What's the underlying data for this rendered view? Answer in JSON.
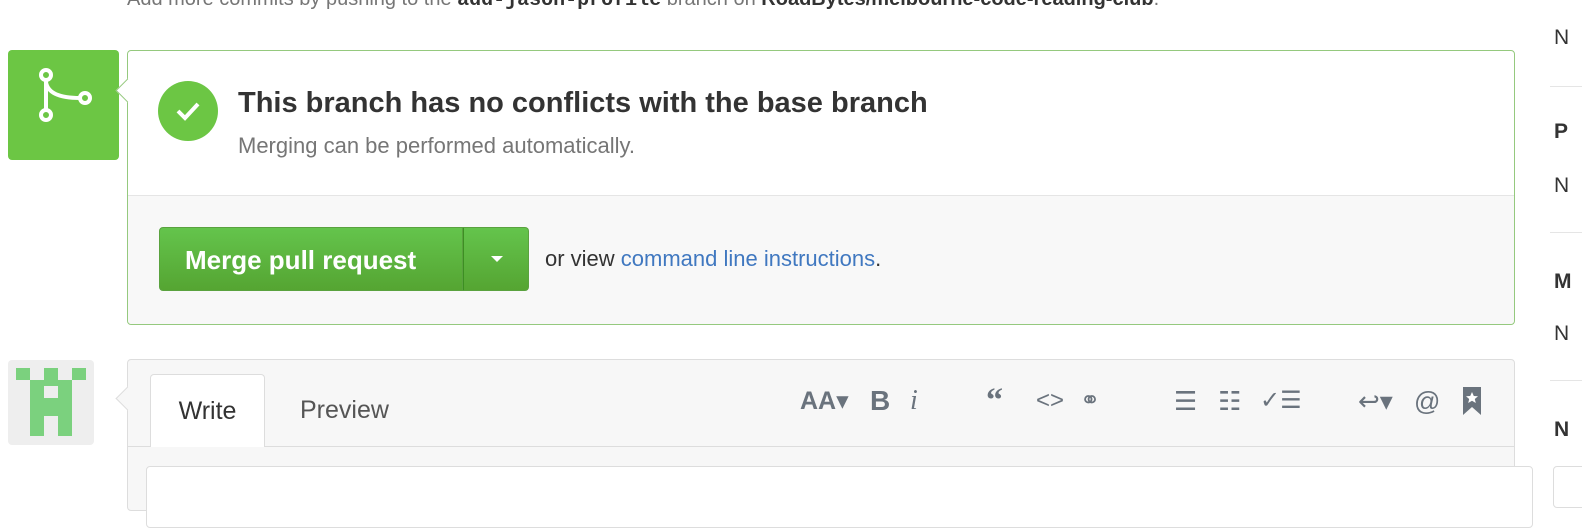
{
  "top_note": {
    "prefix": "Add more commits by pushing to the ",
    "branch": "add-jason-profile",
    "middle": " branch on ",
    "repo": "RoadBytes/melbourne-code-reading-club",
    "suffix": "."
  },
  "merge_status": {
    "title": "This branch has no conflicts with the base branch",
    "subtitle": "Merging can be performed automatically."
  },
  "merge_actions": {
    "merge_button_label": "Merge pull request",
    "or_view_text": "or view ",
    "command_line_link": "command line instructions",
    "period": "."
  },
  "comment": {
    "tabs": [
      {
        "label": "Write",
        "active": true
      },
      {
        "label": "Preview",
        "active": false
      }
    ],
    "toolbar_icons": [
      "text-size-icon",
      "bold-icon",
      "italic-icon",
      "quote-icon",
      "code-icon",
      "link-icon",
      "unordered-list-icon",
      "ordered-list-icon",
      "task-list-icon",
      "reply-icon",
      "mention-icon",
      "bookmark-icon"
    ]
  },
  "sidebar": {
    "letters": [
      "N",
      "P",
      "N",
      "M",
      "N",
      "N"
    ]
  },
  "colors": {
    "success_green": "#6cc644",
    "link_blue": "#4078c0",
    "avatar_green": "#7bd17e"
  }
}
